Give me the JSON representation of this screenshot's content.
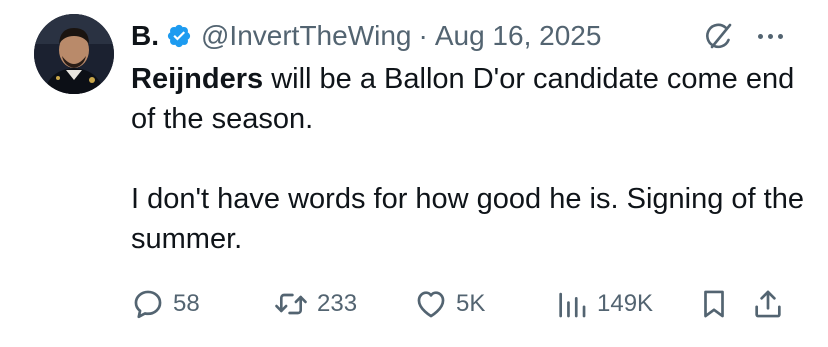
{
  "author": {
    "name": "B.",
    "handle": "@InvertTheWing",
    "separator": "·",
    "date": "Aug 16, 2025"
  },
  "tweet": {
    "bold_lead": "Reijnders",
    "line1_rest": " will be a Ballon D'or candidate come end of the season.",
    "paragraph2": "I don't have words for how good he is. Signing of the summer."
  },
  "metrics": {
    "replies": "58",
    "reposts": "233",
    "likes": "5K",
    "views": "149K"
  },
  "icons": {
    "verified": "verified-badge-icon",
    "grok": "grok-icon",
    "more": "more-icon",
    "reply": "reply-icon",
    "repost": "repost-icon",
    "like": "like-icon",
    "views": "views-icon",
    "bookmark": "bookmark-icon",
    "share": "share-icon"
  },
  "colors": {
    "text": "#0f1419",
    "secondary": "#536471",
    "verified": "#1d9bf0"
  }
}
